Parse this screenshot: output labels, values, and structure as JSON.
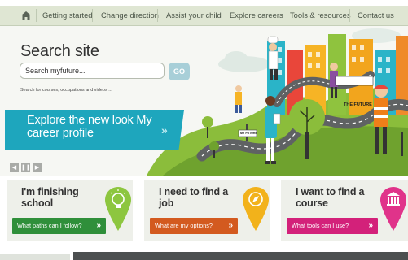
{
  "nav": {
    "items": [
      "Getting started",
      "Change direction",
      "Assist your child",
      "Explore careers",
      "Tools & resources",
      "Contact us"
    ]
  },
  "search": {
    "title": "Search site",
    "placeholder": "Search myfuture...",
    "go_label": "GO",
    "hint": "Search for courses, occupations and videos ..."
  },
  "banner": {
    "text": "Explore the new look My career profile",
    "arrow": "»"
  },
  "slider": {
    "prev": "◀",
    "pause": "❚❚",
    "next": "▶"
  },
  "illustration": {
    "sign_future": "THE FUTURE",
    "sign_path": "MY FUTURE"
  },
  "cards": [
    {
      "title": "I'm finishing school",
      "button": "What paths can I follow?",
      "color": "#2f8f3a",
      "pin_color": "#8dc63f",
      "icon": "lightbulb-icon"
    },
    {
      "title": "I need to find a job",
      "button": "What are my options?",
      "color": "#d35a1f",
      "pin_color": "#f2b21b",
      "icon": "compass-icon"
    },
    {
      "title": "I want to find a course",
      "button": "What tools can I use?",
      "color": "#d3217a",
      "pin_color": "#e0338a",
      "icon": "building-icon"
    }
  ],
  "chevron": "»"
}
